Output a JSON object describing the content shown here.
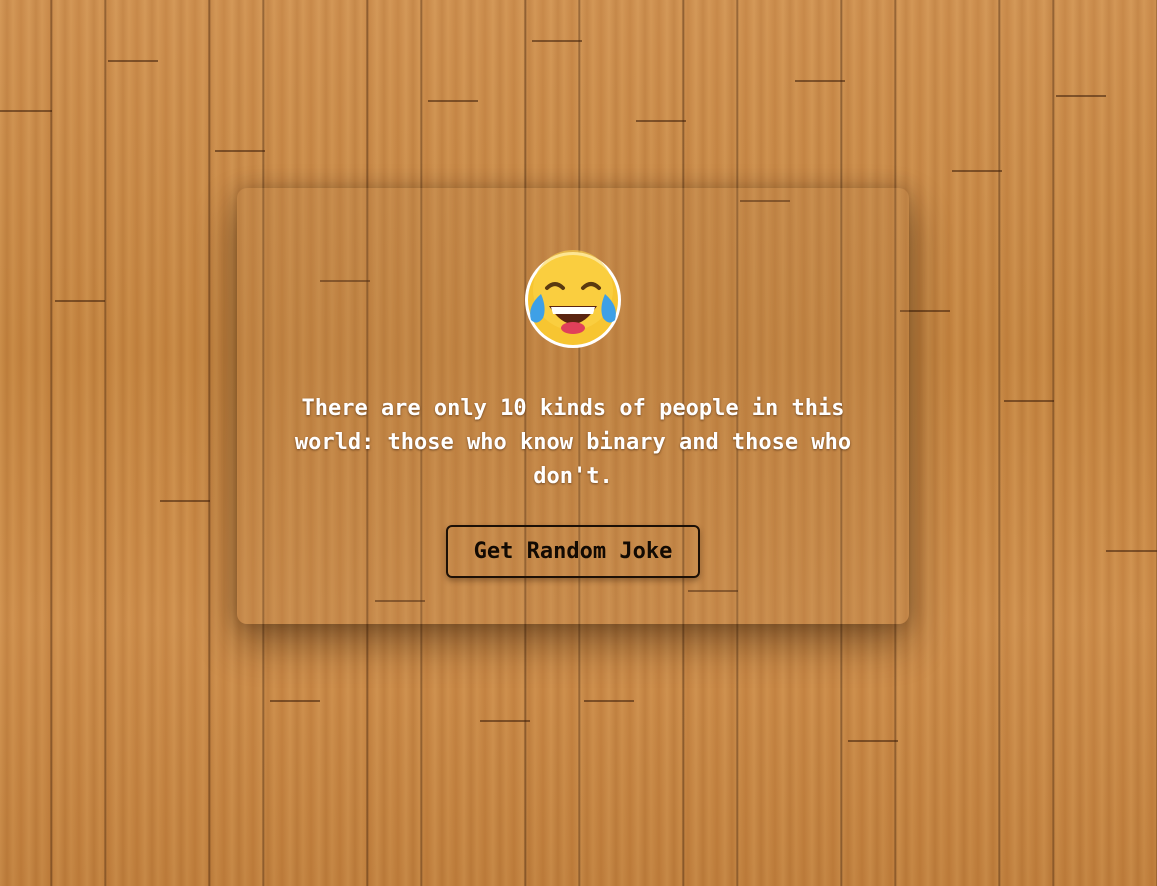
{
  "app": {
    "emoji_icon": "face-with-tears-of-joy-icon",
    "joke_text": "There are only 10 kinds of people in this world: those who know binary and those who don't.",
    "button_label": "Get Random Joke"
  },
  "colors": {
    "joke_text": "#ffffff",
    "button_text": "#120a03",
    "emoji_face": "#f7c531",
    "emoji_tears": "#3ea0e6"
  }
}
